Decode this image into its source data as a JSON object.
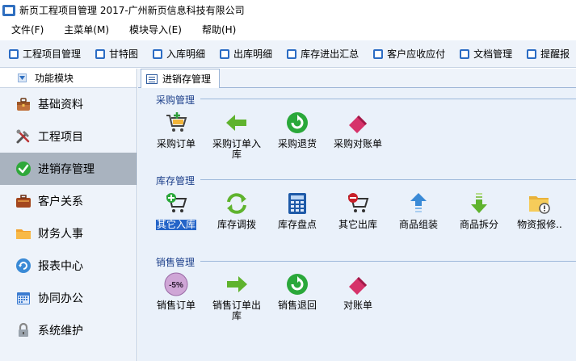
{
  "window": {
    "title": "新页工程项目管理 2017-广州新页信息科技有限公司"
  },
  "menu": [
    {
      "label": "文件(F)"
    },
    {
      "label": "主菜单(M)"
    },
    {
      "label": "模块导入(E)"
    },
    {
      "label": "帮助(H)"
    }
  ],
  "toolbar": [
    {
      "label": "工程项目管理"
    },
    {
      "label": "甘特图"
    },
    {
      "label": "入库明细"
    },
    {
      "label": "出库明细"
    },
    {
      "label": "库存进出汇总"
    },
    {
      "label": "客户应收应付"
    },
    {
      "label": "文档管理"
    },
    {
      "label": "提醒报"
    }
  ],
  "sidebar": {
    "header": "功能模块",
    "items": [
      {
        "label": "基础资料",
        "icon": "toolbox-icon"
      },
      {
        "label": "工程项目",
        "icon": "tools-icon"
      },
      {
        "label": "进销存管理",
        "icon": "check-icon",
        "active": true
      },
      {
        "label": "客户关系",
        "icon": "briefcase-icon"
      },
      {
        "label": "财务人事",
        "icon": "folder-icon"
      },
      {
        "label": "报表中心",
        "icon": "refresh-icon"
      },
      {
        "label": "协同办公",
        "icon": "calendar-icon"
      },
      {
        "label": "系统维护",
        "icon": "lock-icon"
      }
    ]
  },
  "tab": {
    "label": "进销存管理"
  },
  "groups": {
    "purchase": {
      "title": "采购管理",
      "items": [
        {
          "label": "采购订单",
          "icon": "cart-plus-icon"
        },
        {
          "label": "采购订单入库",
          "icon": "arrow-left-icon"
        },
        {
          "label": "采购退货",
          "icon": "green-cycle-icon"
        },
        {
          "label": "采购对账单",
          "icon": "eraser-icon"
        }
      ]
    },
    "stock": {
      "title": "库存管理",
      "items": [
        {
          "label": "其它入库",
          "icon": "cart-add-icon",
          "selected": true
        },
        {
          "label": "库存调拨",
          "icon": "transfer-icon"
        },
        {
          "label": "库存盘点",
          "icon": "calculator-icon"
        },
        {
          "label": "其它出库",
          "icon": "cart-remove-icon"
        },
        {
          "label": "商品组装",
          "icon": "arrow-up-icon"
        },
        {
          "label": "商品拆分",
          "icon": "arrow-down-icon"
        },
        {
          "label": "物资报修..",
          "icon": "folder-warning-icon"
        }
      ]
    },
    "sales": {
      "title": "销售管理",
      "items": [
        {
          "label": "销售订单",
          "icon": "discount-icon",
          "badge": "-5%"
        },
        {
          "label": "销售订单出库",
          "icon": "arrow-right-icon"
        },
        {
          "label": "销售退回",
          "icon": "green-cycle-icon"
        },
        {
          "label": "对账单",
          "icon": "eraser-icon"
        }
      ]
    }
  },
  "colors": {
    "accent": "#2464c8",
    "panel": "#eaf1fa",
    "sidebar_active": "#a9b3bf"
  }
}
